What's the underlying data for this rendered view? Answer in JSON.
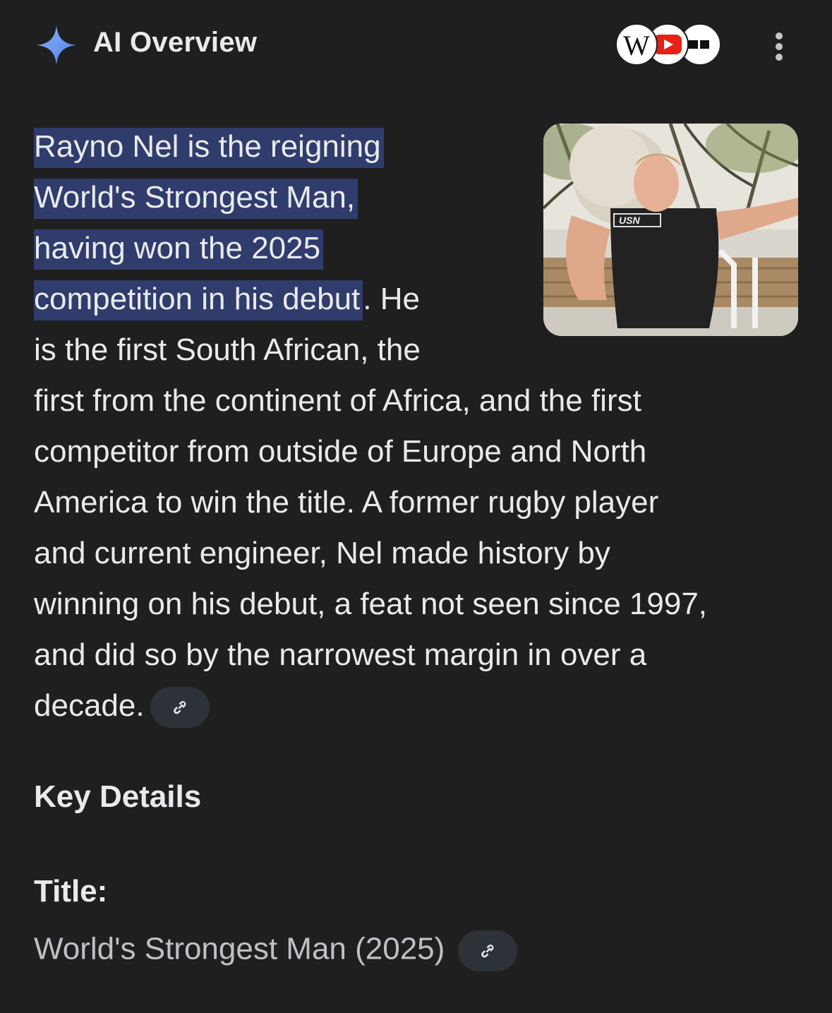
{
  "header": {
    "title": "AI Overview",
    "sources": [
      "wikipedia-icon",
      "youtube-icon",
      "source-icon"
    ]
  },
  "summary": {
    "highlight_lines": [
      "Rayno Nel is the reigning",
      "World's Strongest Man,",
      "having won the 2025",
      "competition in his debut"
    ],
    "after_highlight": ". He",
    "lines": [
      "is the first South African, the",
      "first from the continent of Africa, and the first",
      "competitor from outside of Europe and North",
      "America to win the title. A former rugby player",
      "and current engineer, Nel made history by",
      "winning on his debut, a feat not seen since 1997,",
      "and did so by the narrowest margin in over a",
      "decade."
    ]
  },
  "image": {
    "shirt_text": "USN"
  },
  "key_details": {
    "heading": "Key Details",
    "title_label": "Title:",
    "title_value": "World's Strongest Man (2025)"
  },
  "colors": {
    "background": "#1f1f1f",
    "highlight": "#303c6c",
    "chip": "#2d3238",
    "sparkle": "#6d9df5"
  }
}
